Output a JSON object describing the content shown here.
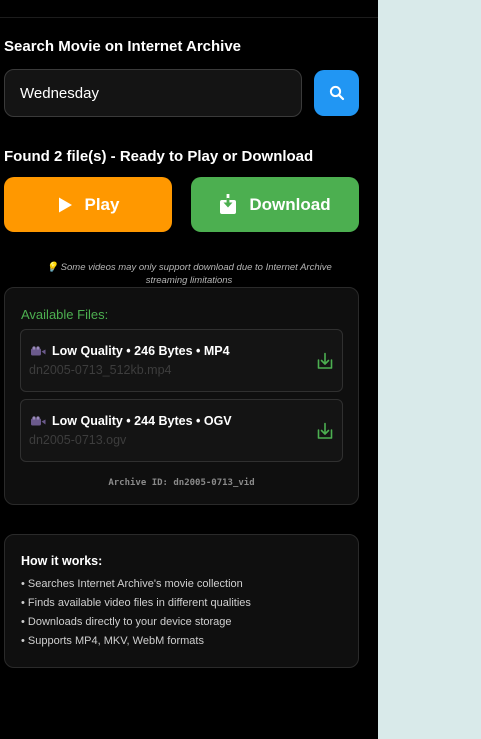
{
  "search": {
    "heading": "Search Movie on Internet Archive",
    "value": "Wednesday"
  },
  "results": {
    "heading": "Found 2 file(s) - Ready to Play or Download",
    "play_label": "Play",
    "download_label": "Download",
    "note_line1": "💡 Some videos may only support download due to Internet Archive",
    "note_line2": "streaming limitations"
  },
  "files": {
    "title": "Available Files:",
    "items": [
      {
        "title": "Low Quality • 246 Bytes • MP4",
        "filename": "dn2005-0713_512kb.mp4",
        "icon": "video-camera-icon"
      },
      {
        "title": "Low Quality • 244 Bytes • OGV",
        "filename": "dn2005-0713.ogv",
        "icon": "video-camera-icon"
      }
    ],
    "archive_id": "Archive ID: dn2005-0713_vid"
  },
  "how": {
    "title": "How it works:",
    "items": [
      "• Searches Internet Archive's movie collection",
      "• Finds available video files in different qualities",
      "• Downloads directly to your device storage",
      "• Supports MP4, MKV, WebM formats"
    ]
  },
  "colors": {
    "panel_bg": "#000000",
    "side_bg": "#d9eaea",
    "search_button": "#2196f3",
    "play_button": "#ff9800",
    "download_button": "#4caf50",
    "files_title": "#4caf50"
  }
}
